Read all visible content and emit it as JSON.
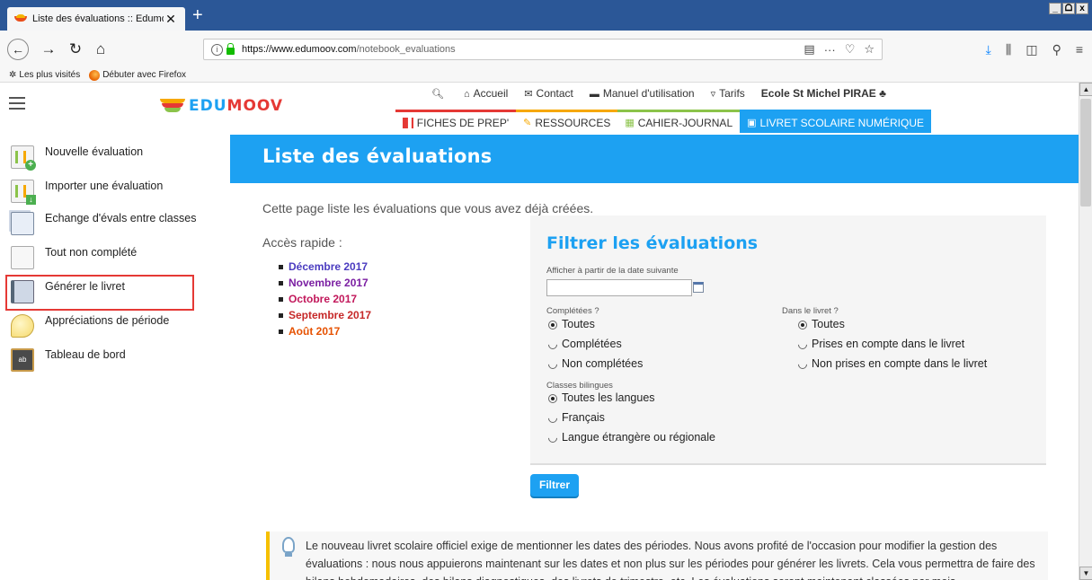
{
  "browser": {
    "tab_title": "Liste des évaluations :: Edumoov",
    "tab_close": "✕",
    "new_tab": "+",
    "url_host": "https://www.edumoov.com",
    "url_path": "/notebook_evaluations",
    "window_buttons": [
      "_",
      "ᗝ",
      "x"
    ],
    "bookmarks": [
      {
        "label": "Les plus visités",
        "icon": "gear-star-icon"
      },
      {
        "label": "Débuter avec Firefox",
        "icon": "firefox-icon"
      }
    ]
  },
  "site": {
    "logo_ed": "EDU",
    "logo_moov": "MOOV",
    "topnav": [
      {
        "icon": "🔍︎",
        "label": ""
      },
      {
        "icon": "⌂",
        "label": "Accueil"
      },
      {
        "icon": "✉",
        "label": "Contact"
      },
      {
        "icon": "▬",
        "label": "Manuel d'utilisation"
      },
      {
        "icon": "▿",
        "label": "Tarifs"
      },
      {
        "icon": "",
        "label": "Ecole St Michel PIRAE ♣"
      }
    ],
    "mainnav": {
      "prep": "FICHES DE PREP'",
      "res": "RESSOURCES",
      "cj": "CAHIER-JOURNAL",
      "livret": "LIVRET SCOLAIRE NUMÉRIQUE"
    }
  },
  "sidebar": {
    "items": [
      {
        "label": "Nouvelle évaluation"
      },
      {
        "label": "Importer une évaluation"
      },
      {
        "label": "Echange d'évals entre classes"
      },
      {
        "label": "Tout non complété"
      },
      {
        "label": "Générer le livret"
      },
      {
        "label": "Appréciations de période"
      },
      {
        "label": "Tableau de bord"
      }
    ]
  },
  "main": {
    "title": "Liste des évaluations",
    "intro": "Cette page liste les évaluations que vous avez déjà créées.",
    "quick_access": "Accès rapide :",
    "months": [
      "Décembre 2017",
      "Novembre 2017",
      "Octobre 2017",
      "Septembre 2017",
      "Août 2017"
    ],
    "filter": {
      "title": "Filtrer les évaluations",
      "date_label": "Afficher à partir de la date suivante",
      "date_value": "",
      "completed_label": "Complétées ?",
      "completed_options": [
        "Toutes",
        "Complétées",
        "Non complétées"
      ],
      "livret_label": "Dans le livret ?",
      "livret_options": [
        "Toutes",
        "Prises en compte dans le livret",
        "Non prises en compte dans le livret"
      ],
      "bilingual_label": "Classes bilingues",
      "bilingual_options": [
        "Toutes les langues",
        "Français",
        "Langue étrangère ou régionale"
      ],
      "button": "Filtrer"
    },
    "info_text": "Le nouveau livret scolaire officiel exige de mentionner les dates des périodes. Nous avons profité de l'occasion pour modifier la gestion des évaluations : nous nous appuierons maintenant sur les dates et non plus sur les périodes pour générer les livrets. Cela vous permettra de faire des bilans hebdomadaires, des bilans diagnostiques, des livrets de trimestre, etc. Les évaluations seront maintenant classées par mois."
  },
  "colors": {
    "accent": "#1da1f2",
    "highlight": "#e53935",
    "browser_tabbar": "#2b5797"
  }
}
